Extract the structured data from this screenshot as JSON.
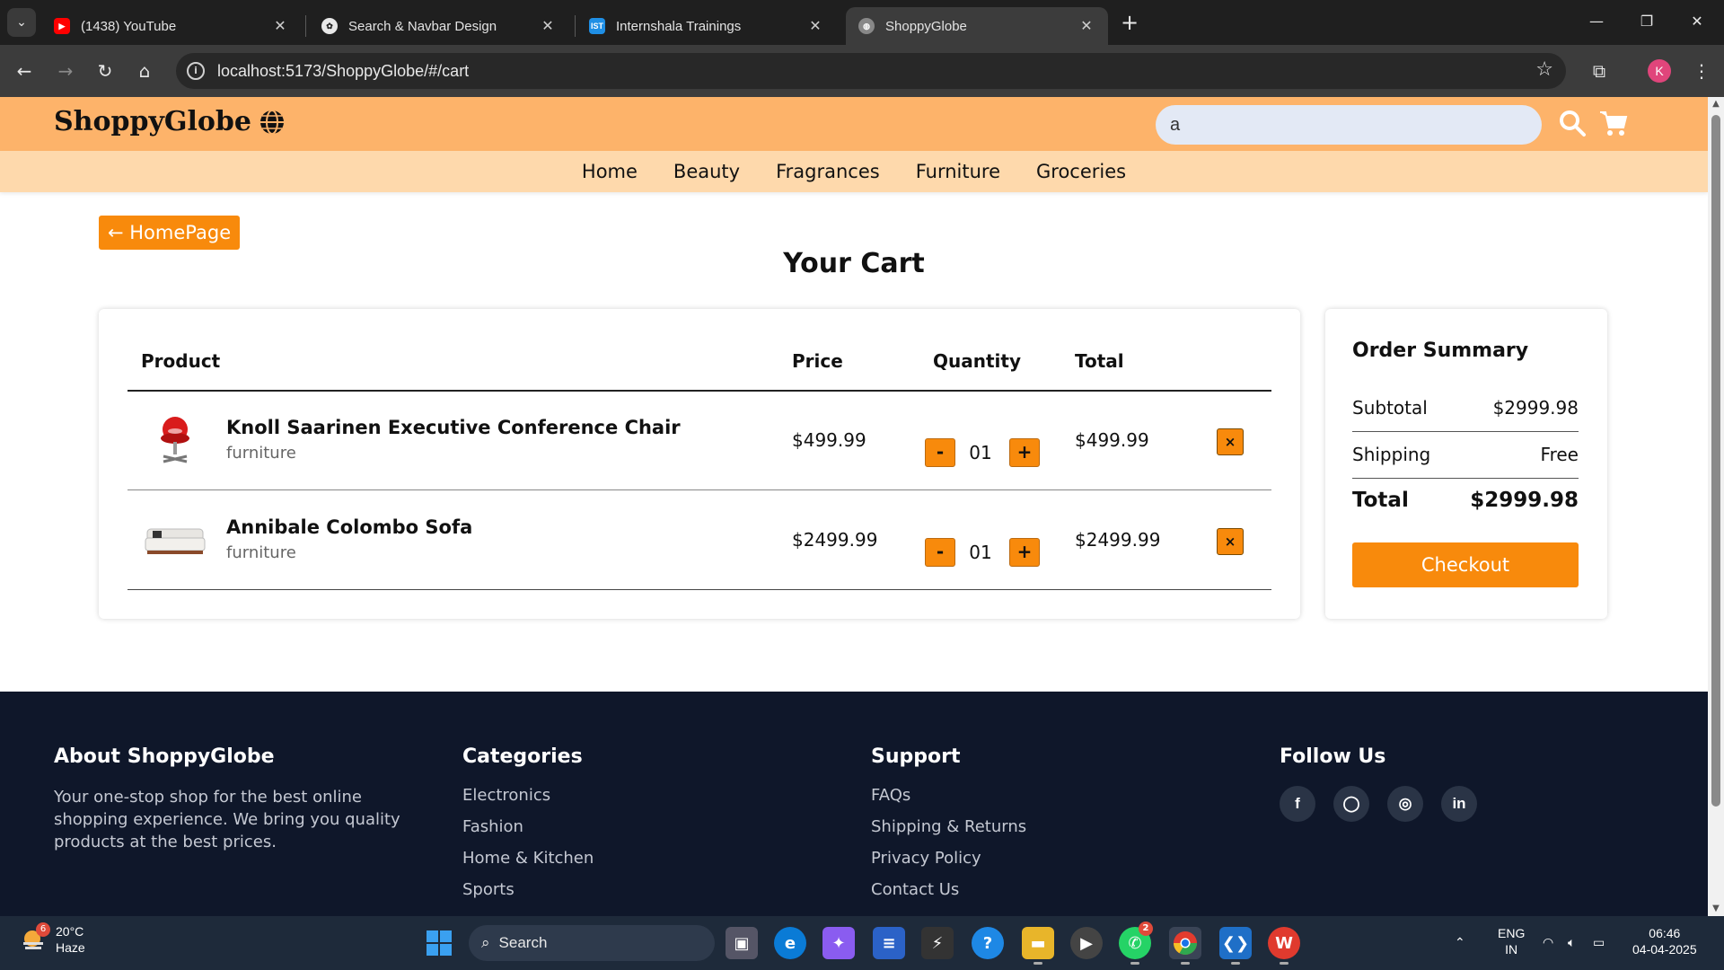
{
  "browser": {
    "tabs": [
      {
        "title": "(1438) YouTube",
        "icon": "youtube-icon"
      },
      {
        "title": "Search & Navbar Design",
        "icon": "openai-icon"
      },
      {
        "title": "Internshala Trainings",
        "icon": "internshala-icon",
        "badge": "IST"
      },
      {
        "title": "ShoppyGlobe",
        "icon": "globe-icon",
        "active": true
      }
    ],
    "url": "localhost:5173/ShoppyGlobe/#/cart",
    "profile_initial": "K"
  },
  "site": {
    "logo": "ShoppyGlobe",
    "search_value": "a",
    "categories": [
      "Home",
      "Beauty",
      "Fragrances",
      "Furniture",
      "Groceries"
    ],
    "accent_color": "#f88a0c",
    "header_color": "#fdb36a"
  },
  "cart": {
    "back_label": "← HomePage",
    "title": "Your Cart",
    "headers": {
      "product": "Product",
      "price": "Price",
      "quantity": "Quantity",
      "total": "Total"
    },
    "items": [
      {
        "name": "Knoll Saarinen Executive Conference Chair",
        "category": "furniture",
        "price": "$499.99",
        "qty": "01",
        "total": "$499.99",
        "image": "red-chair-image"
      },
      {
        "name": "Annibale Colombo Sofa",
        "category": "furniture",
        "price": "$2499.99",
        "qty": "01",
        "total": "$2499.99",
        "image": "sofa-image"
      }
    ],
    "minus_label": "-",
    "plus_label": "+",
    "remove_label": "×"
  },
  "summary": {
    "title": "Order Summary",
    "subtotal_label": "Subtotal",
    "subtotal": "$2999.98",
    "shipping_label": "Shipping",
    "shipping": "Free",
    "total_label": "Total",
    "total": "$2999.98",
    "checkout_label": "Checkout"
  },
  "footer": {
    "about_title": "About ShoppyGlobe",
    "about_text": "Your one-stop shop for the best online shopping experience. We bring you quality products at the best prices.",
    "categories_title": "Categories",
    "categories": [
      "Electronics",
      "Fashion",
      "Home & Kitchen",
      "Sports"
    ],
    "support_title": "Support",
    "support": [
      "FAQs",
      "Shipping & Returns",
      "Privacy Policy",
      "Contact Us"
    ],
    "follow_title": "Follow Us",
    "social": [
      {
        "icon": "facebook-icon",
        "glyph": "f"
      },
      {
        "icon": "github-icon",
        "glyph": "◯"
      },
      {
        "icon": "instagram-icon",
        "glyph": "◎"
      },
      {
        "icon": "linkedin-icon",
        "glyph": "in"
      }
    ]
  },
  "taskbar": {
    "weather_temp": "20°C",
    "weather_desc": "Haze",
    "weather_badge": "6",
    "search_label": "Search",
    "whatsapp_badge": "2",
    "lang_top": "ENG",
    "lang_bottom": "IN",
    "time": "06:46",
    "date": "04-04-2025"
  }
}
